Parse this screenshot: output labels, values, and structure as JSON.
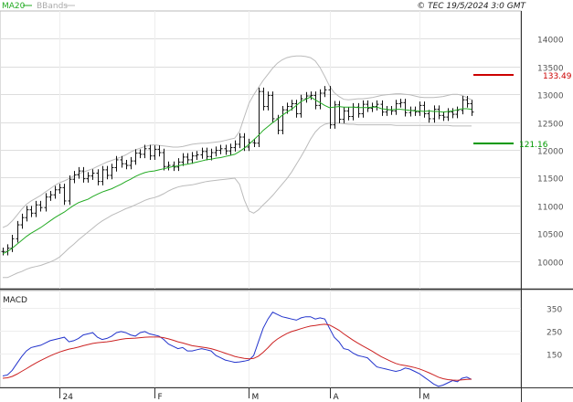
{
  "chart_data": [
    {
      "type": "line",
      "role": "price",
      "legend": [
        {
          "label": "MA20",
          "color": "#22aa22"
        },
        {
          "label": "BBands",
          "color": "#bbbbbb"
        }
      ],
      "copyright": "© TEC 19/5/2024 3:0 GMT",
      "ylim": [
        9500,
        14500
      ],
      "yticks": [
        10000,
        10500,
        11000,
        11500,
        12000,
        12500,
        13000,
        13500,
        14000
      ],
      "ytick_labels": [
        "10000",
        "10500",
        "11000",
        "11500",
        "12000",
        "12500",
        "13000",
        "13500",
        "14000"
      ],
      "xticks": [
        {
          "label": "24",
          "index": 12
        },
        {
          "label": "F",
          "index": 32
        },
        {
          "label": "M",
          "index": 52
        },
        {
          "label": "A",
          "index": 69
        },
        {
          "label": "M",
          "index": 88
        }
      ],
      "grid": true,
      "resistance": {
        "value": 13349,
        "label": "133.49",
        "color": "#cc0000"
      },
      "support": {
        "value": 12116,
        "label": "121.16",
        "color": "#009900"
      },
      "close": [
        10170,
        10230,
        10400,
        10650,
        10780,
        10920,
        10860,
        11010,
        10960,
        11150,
        11190,
        11280,
        11320,
        11080,
        11470,
        11550,
        11620,
        11480,
        11530,
        11580,
        11430,
        11640,
        11540,
        11680,
        11820,
        11750,
        11720,
        11800,
        11940,
        11920,
        12020,
        11890,
        12010,
        11950,
        11700,
        11720,
        11690,
        11780,
        11870,
        11820,
        11890,
        11910,
        11970,
        11880,
        11950,
        11990,
        12020,
        11980,
        12040,
        12100,
        12230,
        12050,
        12130,
        12120,
        13050,
        12780,
        12980,
        12560,
        12350,
        12720,
        12780,
        12830,
        12650,
        12920,
        12970,
        12980,
        12800,
        13020,
        13080,
        12450,
        12810,
        12550,
        12700,
        12600,
        12770,
        12650,
        12820,
        12750,
        12780,
        12820,
        12680,
        12720,
        12700,
        12830,
        12850,
        12670,
        12710,
        12680,
        12800,
        12650,
        12560,
        12730,
        12620,
        12590,
        12680,
        12640,
        12710,
        12900,
        12830,
        12680
      ],
      "ma20": [
        10130,
        10170,
        10230,
        10300,
        10370,
        10440,
        10500,
        10550,
        10600,
        10660,
        10720,
        10780,
        10830,
        10880,
        10940,
        11000,
        11050,
        11080,
        11110,
        11160,
        11200,
        11240,
        11270,
        11300,
        11340,
        11380,
        11430,
        11470,
        11520,
        11560,
        11590,
        11610,
        11620,
        11640,
        11660,
        11680,
        11700,
        11710,
        11730,
        11740,
        11760,
        11780,
        11800,
        11820,
        11830,
        11850,
        11860,
        11880,
        11900,
        11920,
        11970,
        12030,
        12100,
        12180,
        12260,
        12350,
        12420,
        12490,
        12550,
        12620,
        12680,
        12730,
        12800,
        12870,
        12910,
        12950,
        12900,
        12850,
        12800,
        12760,
        12770,
        12780,
        12770,
        12770,
        12770,
        12760,
        12760,
        12760,
        12770,
        12770,
        12740,
        12730,
        12720,
        12730,
        12730,
        12720,
        12710,
        12700,
        12700,
        12690,
        12700,
        12690,
        12690,
        12680,
        12690,
        12700,
        12720,
        12740,
        12740,
        12730
      ],
      "bb_upper": [
        10600,
        10640,
        10720,
        10820,
        10930,
        11020,
        11080,
        11130,
        11180,
        11240,
        11300,
        11360,
        11410,
        11440,
        11480,
        11530,
        11570,
        11600,
        11630,
        11660,
        11700,
        11740,
        11780,
        11810,
        11840,
        11870,
        11910,
        11960,
        12000,
        12030,
        12060,
        12080,
        12090,
        12080,
        12070,
        12060,
        12050,
        12050,
        12060,
        12080,
        12100,
        12110,
        12120,
        12120,
        12130,
        12140,
        12150,
        12170,
        12190,
        12210,
        12330,
        12590,
        12840,
        12990,
        13120,
        13250,
        13360,
        13470,
        13560,
        13620,
        13660,
        13680,
        13690,
        13690,
        13680,
        13660,
        13600,
        13480,
        13320,
        13150,
        13030,
        12960,
        12910,
        12900,
        12910,
        12920,
        12920,
        12930,
        12940,
        12960,
        12980,
        12990,
        13000,
        13010,
        13010,
        13000,
        12990,
        12970,
        12950,
        12940,
        12940,
        12940,
        12950,
        12960,
        12980,
        13000,
        13000,
        12980,
        12940,
        12900
      ],
      "bb_lower": [
        9700,
        9700,
        9740,
        9780,
        9810,
        9850,
        9880,
        9900,
        9920,
        9950,
        9980,
        10020,
        10070,
        10150,
        10230,
        10300,
        10380,
        10450,
        10520,
        10590,
        10660,
        10720,
        10770,
        10820,
        10860,
        10900,
        10940,
        10970,
        11010,
        11050,
        11090,
        11120,
        11140,
        11170,
        11210,
        11260,
        11300,
        11330,
        11350,
        11360,
        11370,
        11390,
        11410,
        11430,
        11440,
        11450,
        11460,
        11470,
        11480,
        11490,
        11380,
        11100,
        10900,
        10860,
        10920,
        11010,
        11090,
        11180,
        11280,
        11380,
        11480,
        11600,
        11740,
        11880,
        12030,
        12190,
        12320,
        12410,
        12460,
        12480,
        12480,
        12480,
        12470,
        12460,
        12460,
        12450,
        12450,
        12450,
        12450,
        12450,
        12450,
        12450,
        12450,
        12440,
        12440,
        12440,
        12440,
        12440,
        12440,
        12440,
        12440,
        12440,
        12440,
        12440,
        12440,
        12430,
        12430,
        12430,
        12430,
        12430
      ]
    },
    {
      "type": "line",
      "role": "macd",
      "title": "MACD",
      "ylim": [
        0,
        425
      ],
      "yticks": [
        150,
        250,
        350
      ],
      "ytick_labels": [
        "150",
        "250",
        "350"
      ],
      "series": [
        {
          "color": "#2233cc",
          "values": [
            50,
            55,
            75,
            105,
            135,
            160,
            175,
            180,
            185,
            195,
            205,
            210,
            215,
            220,
            200,
            205,
            215,
            230,
            235,
            240,
            220,
            210,
            215,
            225,
            240,
            245,
            240,
            230,
            225,
            240,
            245,
            235,
            230,
            225,
            210,
            190,
            180,
            170,
            175,
            160,
            160,
            165,
            170,
            165,
            160,
            140,
            130,
            120,
            115,
            110,
            112,
            115,
            120,
            140,
            200,
            260,
            300,
            330,
            320,
            310,
            305,
            300,
            295,
            305,
            310,
            310,
            300,
            305,
            300,
            260,
            220,
            200,
            170,
            165,
            150,
            140,
            135,
            130,
            110,
            90,
            85,
            80,
            75,
            70,
            75,
            85,
            80,
            70,
            60,
            45,
            30,
            15,
            5,
            10,
            20,
            30,
            25,
            40,
            45,
            35
          ]
        },
        {
          "color": "#cc2222",
          "values": [
            40,
            42,
            48,
            58,
            70,
            82,
            95,
            107,
            118,
            128,
            138,
            147,
            155,
            162,
            168,
            172,
            177,
            183,
            188,
            193,
            196,
            198,
            200,
            203,
            207,
            211,
            214,
            215,
            216,
            218,
            220,
            221,
            221,
            221,
            218,
            213,
            207,
            200,
            195,
            189,
            183,
            180,
            177,
            174,
            170,
            164,
            157,
            150,
            143,
            136,
            131,
            127,
            125,
            127,
            137,
            154,
            174,
            196,
            212,
            225,
            236,
            245,
            251,
            258,
            264,
            269,
            272,
            275,
            277,
            274,
            263,
            251,
            235,
            221,
            207,
            194,
            182,
            171,
            159,
            146,
            134,
            124,
            114,
            105,
            99,
            96,
            92,
            87,
            81,
            73,
            64,
            55,
            45,
            38,
            34,
            32,
            31,
            33,
            35,
            36
          ]
        }
      ],
      "zero_line": 40
    }
  ]
}
